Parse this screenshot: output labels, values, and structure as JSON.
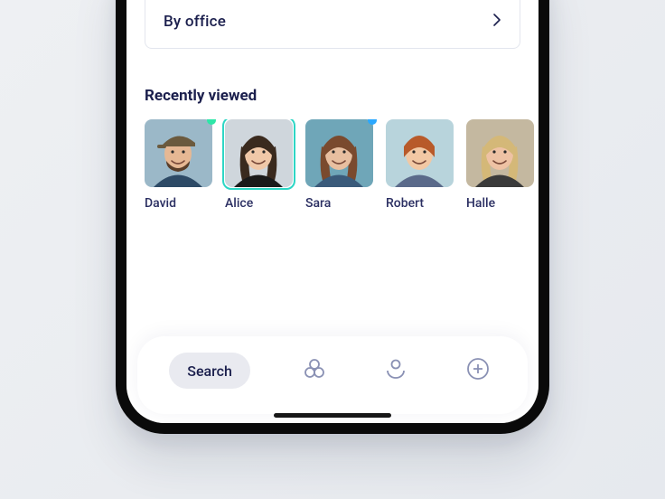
{
  "filters": {
    "by_office_label": "By office"
  },
  "section": {
    "recently_viewed_title": "Recently viewed"
  },
  "people": [
    {
      "name": "David",
      "selected": false,
      "status_color": "#2ee6a8",
      "bg": "#9bb8c8",
      "shirt": "#2d4a66",
      "skin": "#e6b894",
      "hair": "#6b5a3e",
      "beard": true,
      "cap": true
    },
    {
      "name": "Alice",
      "selected": true,
      "status_color": null,
      "bg": "#cfd6dc",
      "shirt": "#1a1a1a",
      "skin": "#f0c8a8",
      "hair": "#3a2a1e",
      "beard": false,
      "cap": false
    },
    {
      "name": "Sara",
      "selected": false,
      "status_color": "#2aa8ff",
      "bg": "#6fa6b8",
      "shirt": "#3a5a7a",
      "skin": "#e8bfa0",
      "hair": "#7a4a2e",
      "beard": false,
      "cap": false
    },
    {
      "name": "Robert",
      "selected": false,
      "status_color": null,
      "bg": "#b8d4dc",
      "shirt": "#5a6a8a",
      "skin": "#f2c8a4",
      "hair": "#b85a2a",
      "beard": false,
      "cap": false
    },
    {
      "name": "Halle",
      "selected": false,
      "status_color": null,
      "bg": "#c4b8a0",
      "shirt": "#3a3a3a",
      "skin": "#eec2a4",
      "hair": "#d4b878",
      "beard": false,
      "cap": false
    }
  ],
  "tabs": {
    "search_label": "Search"
  },
  "colors": {
    "ink": "#1b1f4d",
    "accent": "#2dd6c5"
  }
}
